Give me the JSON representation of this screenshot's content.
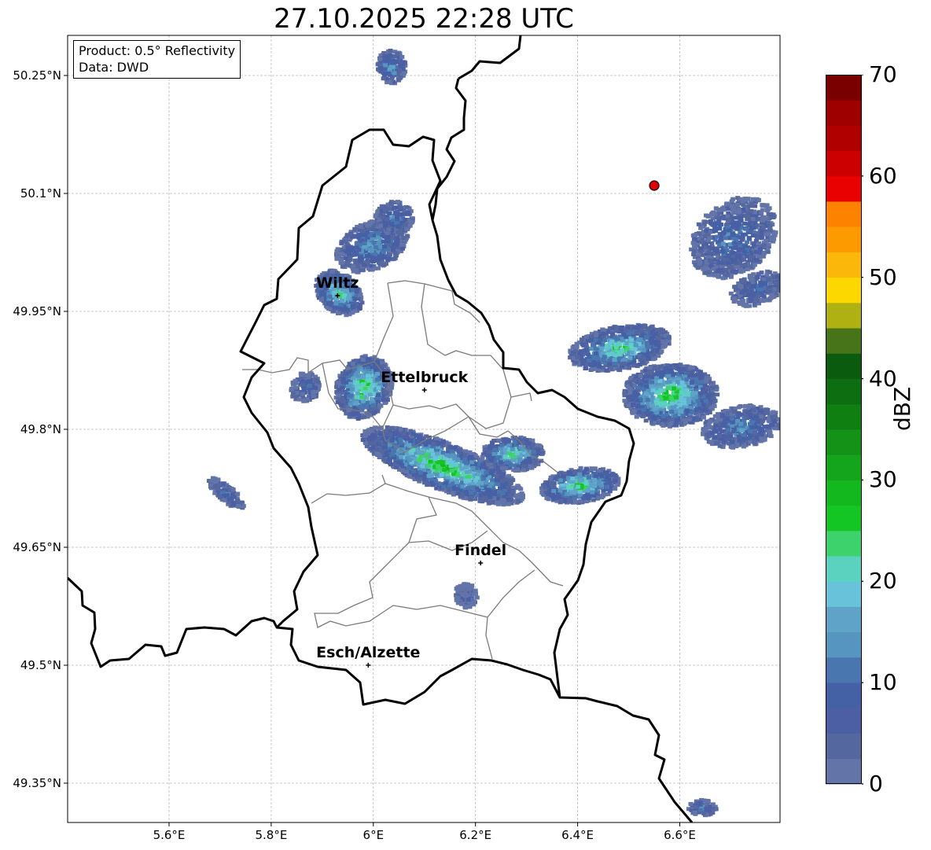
{
  "title": "27.10.2025 22:28 UTC",
  "info": {
    "product": "Product: 0.5° Reflectivity",
    "source": "Data: DWD"
  },
  "axes": {
    "lon_ticks": [
      "5.6°E",
      "5.8°E",
      "6°E",
      "6.2°E",
      "6.4°E",
      "6.6°E"
    ],
    "lat_ticks": [
      "50.25°N",
      "50.1°N",
      "49.95°N",
      "49.8°N",
      "49.65°N",
      "49.5°N",
      "49.35°N"
    ],
    "grid": true
  },
  "places": [
    {
      "name": "Wiltz",
      "lon": 5.93,
      "lat": 49.97
    },
    {
      "name": "Ettelbruck",
      "lon": 6.1,
      "lat": 49.85
    },
    {
      "name": "Findel",
      "lon": 6.21,
      "lat": 49.63
    },
    {
      "name": "Esch/Alzette",
      "lon": 5.99,
      "lat": 49.5
    }
  ],
  "radar_site": {
    "lon": 6.55,
    "lat": 50.11,
    "color": "#e30000"
  },
  "colorbar": {
    "label": "dBZ",
    "min": 0,
    "max": 70,
    "step": 2.5,
    "ticks": [
      "0",
      "10",
      "20",
      "30",
      "40",
      "50",
      "60",
      "70"
    ],
    "colors": [
      "#6274a8",
      "#55679f",
      "#4c5fa4",
      "#4561a5",
      "#4a76b0",
      "#5595c0",
      "#5fa3c9",
      "#68c2d9",
      "#5bd2c0",
      "#3dd26c",
      "#13c624",
      "#13b81f",
      "#15a51d",
      "#139217",
      "#0f7f12",
      "#0d6d11",
      "#0a5b0d",
      "#487419",
      "#afb011",
      "#fcd800",
      "#fcb80a",
      "#fc9a00",
      "#fc8200",
      "#e90000",
      "#cc0000",
      "#b10000",
      "#9e0000",
      "#7a0000",
      "#ffe0ff",
      "#ffb3ff",
      "#ff6aff",
      "#e639e9"
    ]
  }
}
